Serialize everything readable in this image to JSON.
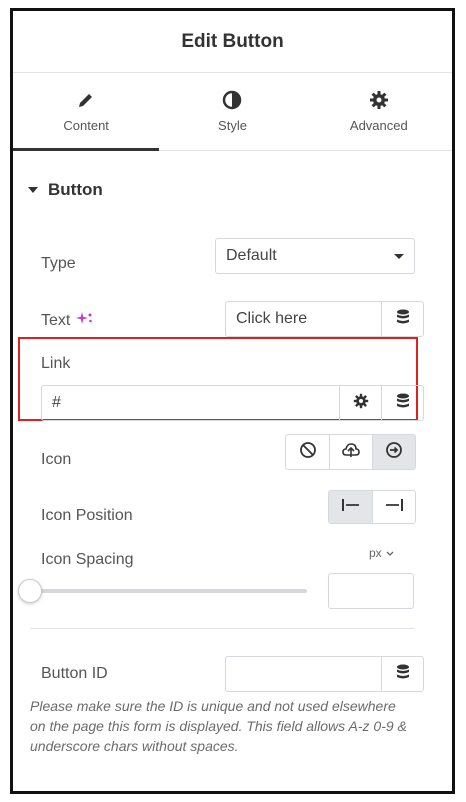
{
  "header": {
    "title": "Edit Button"
  },
  "tabs": [
    {
      "label": "Content",
      "icon": "pencil-icon",
      "active": true
    },
    {
      "label": "Style",
      "icon": "half-circle-icon",
      "active": false
    },
    {
      "label": "Advanced",
      "icon": "gear-icon",
      "active": false
    }
  ],
  "section": {
    "title": "Button"
  },
  "fields": {
    "type": {
      "label": "Type",
      "value": "Default"
    },
    "text": {
      "label": "Text",
      "value": "Click here"
    },
    "link": {
      "label": "Link",
      "value": "#"
    },
    "icon": {
      "label": "Icon",
      "options": [
        "none-icon",
        "upload-icon",
        "arrow-circle-icon"
      ],
      "selected": "arrow-circle-icon"
    },
    "icon_position": {
      "label": "Icon Position",
      "options": [
        "align-start-icon",
        "align-end-icon"
      ],
      "selected": "align-start-icon"
    },
    "icon_spacing": {
      "label": "Icon Spacing",
      "unit": "px",
      "value": ""
    },
    "button_id": {
      "label": "Button ID",
      "value": "",
      "help": "Please make sure the ID is unique and not used elsewhere on the page this form is displayed. This field allows A-z 0-9 & underscore chars without spaces."
    }
  },
  "colors": {
    "highlight": "#e0201f",
    "ai_sparkle": "#c73cc6",
    "active_tab": "#333333"
  }
}
